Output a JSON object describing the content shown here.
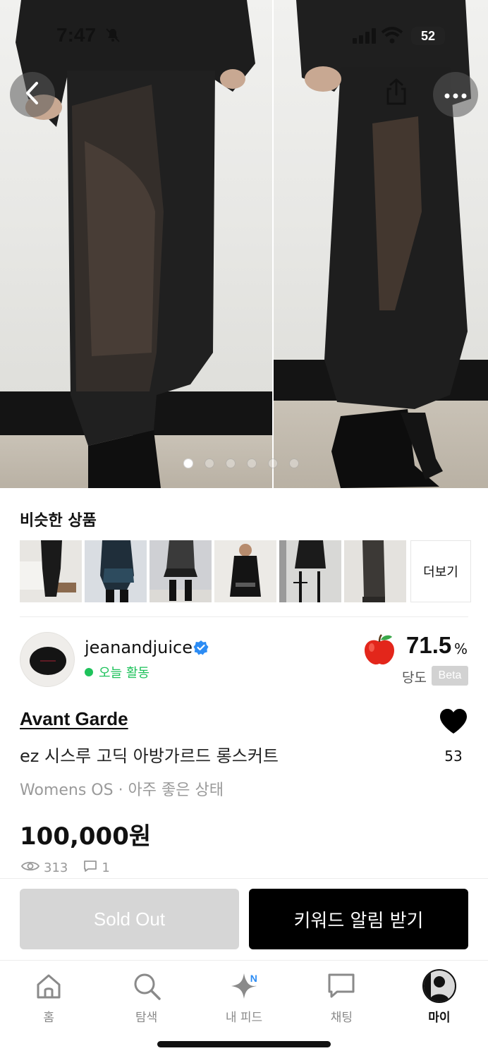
{
  "status_bar": {
    "time": "7:47",
    "battery": "52"
  },
  "similar": {
    "title": "비슷한 상품",
    "more_label": "더보기"
  },
  "seller": {
    "name": "jeanandjuice",
    "activity": "오늘 활동",
    "sweetness_value": "71.5",
    "sweetness_unit": "%",
    "sweetness_label": "당도",
    "beta_label": "Beta"
  },
  "product": {
    "brand": "Avant Garde",
    "title": "ez 시스루 고딕 아방가르드 롱스커트",
    "meta": "Womens OS · 아주 좋은 상태",
    "price": "100,000원",
    "views": "313",
    "comments": "1",
    "likes": "53"
  },
  "actions": {
    "soldout_label": "Sold Out",
    "keyword_label": "키워드 알림 받기"
  },
  "tabs": {
    "home": "홈",
    "search": "탐색",
    "feed": "내 피드",
    "feed_badge": "N",
    "chat": "채팅",
    "my": "마이"
  },
  "colors": {
    "accent_green": "#1ec25b",
    "verified_blue": "#2c8cf4",
    "soldout_gray": "#d6d6d6",
    "primary_black": "#000000"
  },
  "icons": [
    "back-icon",
    "share-icon",
    "more-icon",
    "verified-icon",
    "apple-icon",
    "heart-icon",
    "eye-icon",
    "comment-icon",
    "home-icon",
    "search-icon",
    "sparkle-icon",
    "chat-icon"
  ]
}
